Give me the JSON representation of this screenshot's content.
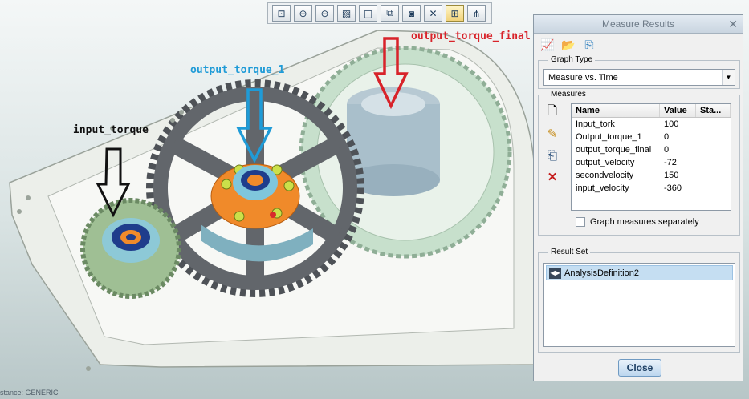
{
  "toolbar": {
    "buttons": [
      "zoom-fit-icon",
      "zoom-in-icon",
      "zoom-out-icon",
      "repaint-icon",
      "view-orient-icon",
      "saved-views-icon",
      "display-style-icon",
      "datum-icon",
      "spin-center-icon",
      "mechanism-icon"
    ]
  },
  "annotations": {
    "input": "input_torque",
    "output1": "output_torque_1",
    "final": "output_torque_final",
    "colors": {
      "input": "#111111",
      "output1": "#1f9bd7",
      "final": "#d8232a"
    }
  },
  "status_text": "stance: GENERIC",
  "dialog": {
    "title": "Measure Results",
    "graph_type_label": "Graph Type",
    "graph_type_value": "Measure vs. Time",
    "measures_label": "Measures",
    "columns": [
      "Name",
      "Value",
      "Sta..."
    ],
    "rows": [
      {
        "name": "Input_tork",
        "value": "100"
      },
      {
        "name": "Output_torque_1",
        "value": "0"
      },
      {
        "name": "output_torque_final",
        "value": "0"
      },
      {
        "name": "output_velocity",
        "value": "-72"
      },
      {
        "name": "secondvelocity",
        "value": "150"
      },
      {
        "name": "input_velocity",
        "value": "-360"
      }
    ],
    "graph_separately": "Graph measures separately",
    "result_set_label": "Result Set",
    "result_item": "AnalysisDefinition2",
    "close_label": "Close"
  }
}
